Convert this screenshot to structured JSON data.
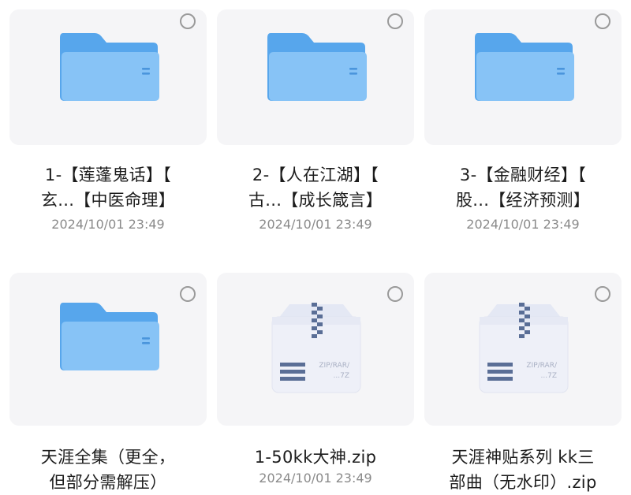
{
  "colors": {
    "folder_back": "#57a6ec",
    "folder_front": "#87c3f6",
    "tile_bg": "#f5f5f7",
    "zip_body": "#eef0f8"
  },
  "items": [
    {
      "type": "folder",
      "icon": "folder-icon",
      "name_line1": "1-【莲蓬鬼话】【",
      "name_line2": "玄...【中医命理】",
      "date": "2024/10/01 23:49"
    },
    {
      "type": "folder",
      "icon": "folder-icon",
      "name_line1": "2-【人在江湖】【",
      "name_line2": "古...【成长箴言】",
      "date": "2024/10/01 23:49"
    },
    {
      "type": "folder",
      "icon": "folder-icon",
      "name_line1": "3-【金融财经】【",
      "name_line2": "股...【经济预测】",
      "date": "2024/10/01 23:49"
    },
    {
      "type": "folder",
      "icon": "folder-icon",
      "name_line1": "天涯全集（更全，",
      "name_line2": "但部分需解压）",
      "date": ""
    },
    {
      "type": "archive",
      "icon": "zip-archive-icon",
      "icon_text": "ZIP/RAR/...7Z",
      "name_line1": "1-50kk大神.zip",
      "name_line2": "",
      "date": "2024/10/01 23:49"
    },
    {
      "type": "archive",
      "icon": "zip-archive-icon",
      "icon_text": "ZIP/RAR/...7Z",
      "name_line1": "天涯神贴系列 kk三",
      "name_line2": "部曲（无水印）.zip",
      "date": ""
    }
  ]
}
